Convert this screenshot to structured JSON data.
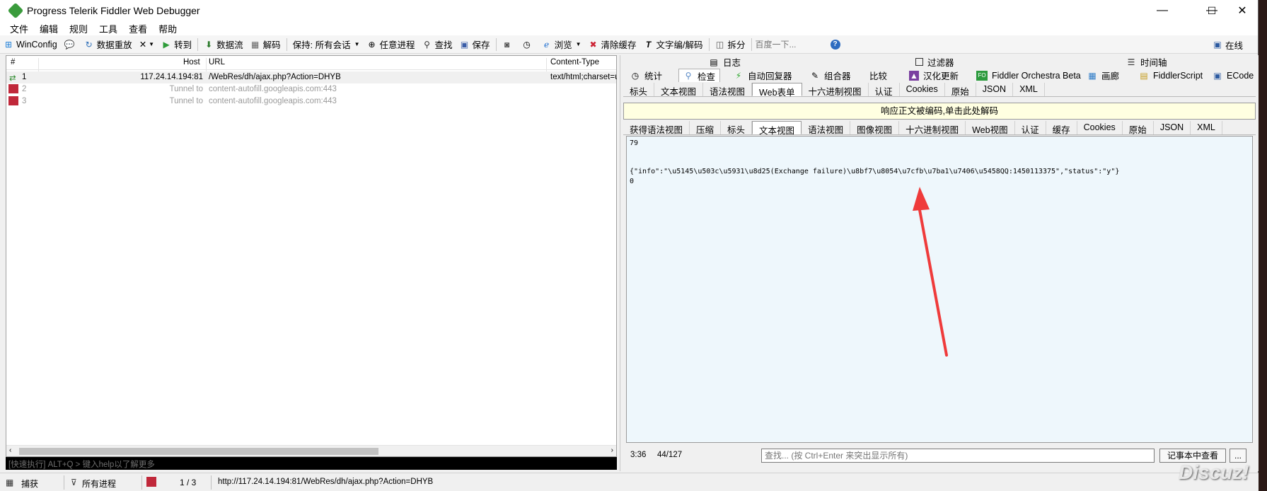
{
  "window": {
    "title": "Progress Telerik Fiddler Web Debugger",
    "minimize": "—",
    "maximize": "☐",
    "close": "✕"
  },
  "menu": [
    "文件",
    "编辑",
    "规则",
    "工具",
    "查看",
    "帮助"
  ],
  "toolbar": {
    "winconfig": "WinConfig",
    "replay": "数据重放",
    "remove": "✕",
    "goto": "转到",
    "stream": "数据流",
    "decode": "解码",
    "keep": "保持: 所有会话",
    "any_process": "任意进程",
    "find": "查找",
    "save": "保存",
    "browse": "浏览",
    "clear_cache": "清除缓存",
    "text_encode": "文字编/解码",
    "split": "拆分",
    "search_placeholder": "百度一下...",
    "online": "在线"
  },
  "sessions": {
    "headers": {
      "num": "#",
      "host": "Host",
      "url": "URL",
      "content_type": "Content-Type"
    },
    "rows": [
      {
        "num": "1",
        "host": "117.24.14.194:81",
        "url": "/WebRes/dh/ajax.php?Action=DHYB",
        "content_type": "text/html;charset=u"
      },
      {
        "num": "2",
        "host": "Tunnel to",
        "url": "content-autofill.googleapis.com:443",
        "content_type": ""
      },
      {
        "num": "3",
        "host": "Tunnel to",
        "url": "content-autofill.googleapis.com:443",
        "content_type": ""
      }
    ]
  },
  "quickexec": "[快速执行] ALT+Q > 键入help以了解更多",
  "right": {
    "tabs_row1": [
      "日志",
      "过滤器",
      "时间轴"
    ],
    "tabs_row2": [
      "统计",
      "检查",
      "自动回复器",
      "组合器",
      "比较",
      "汉化更新",
      "Fiddler Orchestra Beta",
      "画廊",
      "FiddlerScript",
      "ECode"
    ],
    "request_tabs": [
      "标头",
      "文本视图",
      "语法视图",
      "Web表单",
      "十六进制视图",
      "认证",
      "Cookies",
      "原始",
      "JSON",
      "XML"
    ],
    "decode_notice": "响应正文被编码,单击此处解码",
    "response_tabs": [
      "获得语法视图",
      "压缩",
      "标头",
      "文本视图",
      "语法视图",
      "图像视图",
      "十六进制视图",
      "Web视图",
      "认证",
      "缓存",
      "Cookies",
      "原始",
      "JSON",
      "XML"
    ],
    "body_lines": [
      "79",
      "",
      "",
      "{\"info\":\"\\u5145\\u503c\\u5931\\u8d25(Exchange failure)\\u8bf7\\u8054\\u7cfb\\u7ba1\\u7406\\u5458QQ:1450113375\",\"status\":\"y\"}",
      "0"
    ],
    "cursor_pos": "3:36",
    "char_pos": "44/127",
    "find_placeholder": "查找... (按 Ctrl+Enter 来突出显示所有)",
    "notepad_button": "记事本中查看",
    "more_button": "..."
  },
  "status": {
    "capture": "捕获",
    "processes": "所有进程",
    "count": "1 / 3",
    "url": "http://117.24.14.194:81/WebRes/dh/ajax.php?Action=DHYB"
  },
  "watermark": "Discuz!",
  "colors": {
    "decode_bar": "#ffffe1",
    "body_bg": "#eef7fc",
    "arrow": "#ef3b3b"
  }
}
